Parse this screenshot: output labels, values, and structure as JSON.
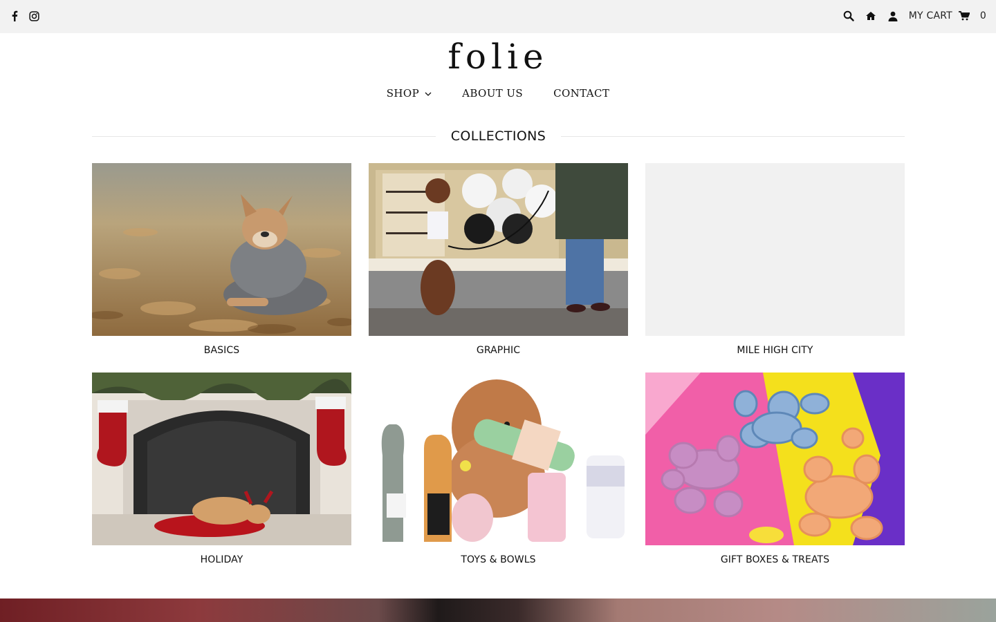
{
  "topbar": {
    "social_icons": [
      "facebook-icon",
      "instagram-icon"
    ],
    "tool_icons": [
      "search-icon",
      "home-icon",
      "user-icon"
    ],
    "cart_label": "MY CART",
    "cart_count": "0"
  },
  "logo": {
    "text": "folie"
  },
  "nav": {
    "items": [
      {
        "label": "SHOP",
        "has_dropdown": true
      },
      {
        "label": "ABOUT US"
      },
      {
        "label": "CONTACT"
      }
    ]
  },
  "collections": {
    "heading": "COLLECTIONS",
    "items": [
      {
        "label": "BASICS",
        "image": "french bulldog in gray hoodie lying in autumn leaves"
      },
      {
        "label": "GRAPHIC",
        "image": "brown poodle in graphic shirt at shop window"
      },
      {
        "label": "MILE HIGH CITY",
        "image": ""
      },
      {
        "label": "HOLIDAY",
        "image": "dog with antlers sleeping by fireplace with stockings"
      },
      {
        "label": "TOYS & BOWLS",
        "image": "dog with plush bottle toys"
      },
      {
        "label": "GIFT BOXES & TREATS",
        "image": "balloon-dog shaped cookies on colorful paper"
      }
    ]
  },
  "colors": {
    "topbar_bg": "#f2f2f2",
    "placeholder_bg": "#f1f1f1",
    "text": "#111111"
  }
}
